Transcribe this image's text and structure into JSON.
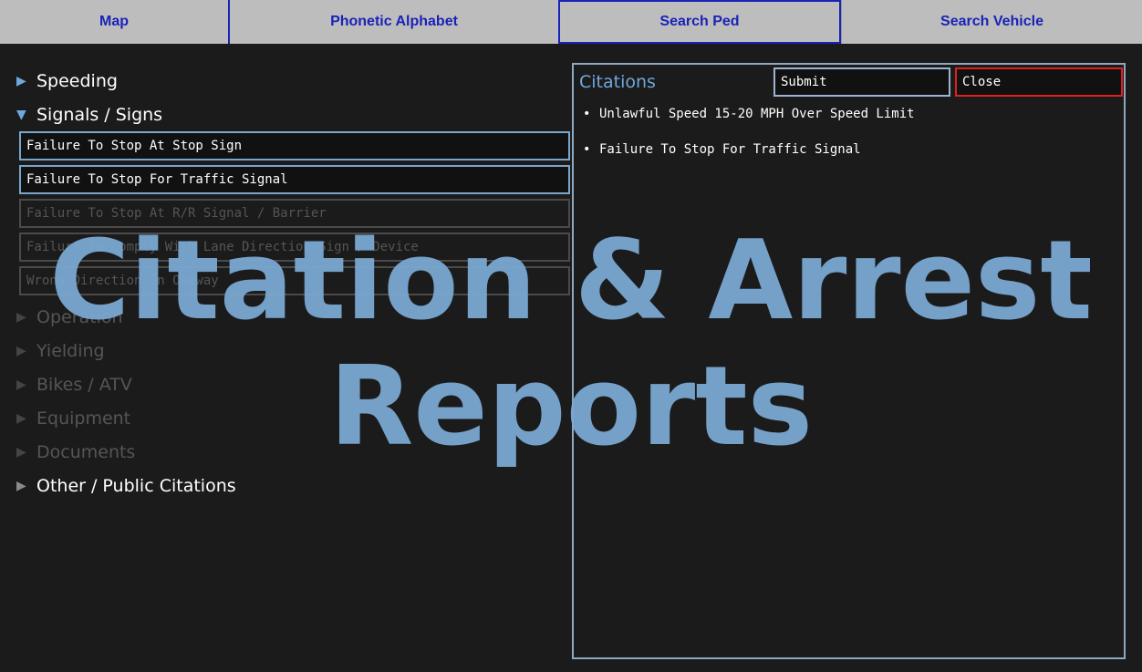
{
  "nav": {
    "tabs": [
      {
        "label": "Map"
      },
      {
        "label": "Phonetic Alphabet"
      },
      {
        "label": "Search Ped"
      },
      {
        "label": "Search Vehicle"
      }
    ]
  },
  "categories": {
    "speeding": "Speeding",
    "signals": "Signals / Signs",
    "operation": "Operation",
    "yielding": "Yielding",
    "bikes": "Bikes / ATV",
    "equipment": "Equipment",
    "documents": "Documents",
    "other": "Other / Public Citations"
  },
  "violations": [
    "Failure To Stop At Stop Sign",
    "Failure To Stop For Traffic Signal",
    "Failure To Stop At R/R Signal / Barrier",
    "Failure To Comply With Lane Direction Sign / Device",
    "Wrong Direction On Oneway"
  ],
  "citations_panel": {
    "title": "Citations",
    "submit_label": "Submit",
    "close_label": "Close",
    "items": [
      "Unlawful Speed 15-20 MPH Over Speed Limit",
      "Failure To Stop For Traffic Signal"
    ]
  },
  "overlay": {
    "line1": "Citation & Arrest",
    "line2": "Reports"
  },
  "colors": {
    "accent": "#6fa8dc",
    "tab_text": "#1a23b8",
    "close_border": "#e02020"
  }
}
